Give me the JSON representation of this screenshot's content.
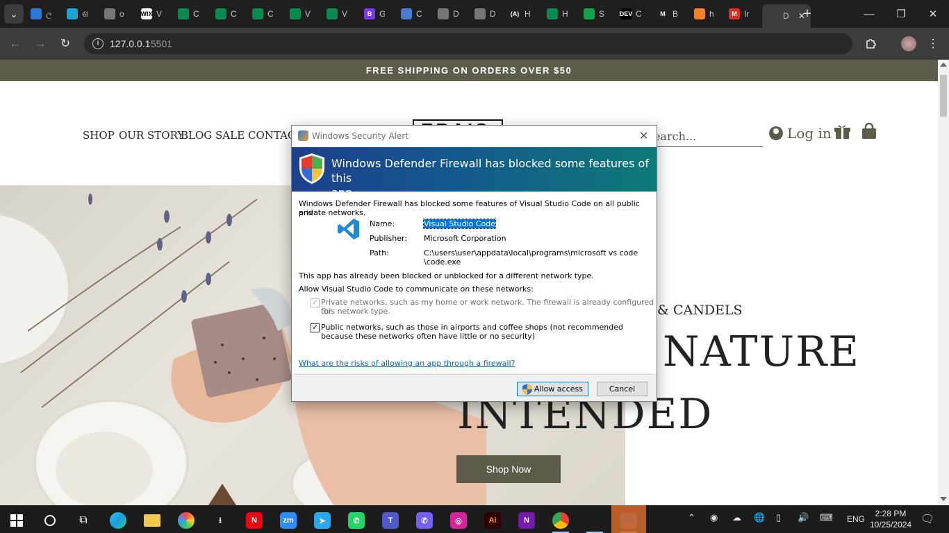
{
  "browser": {
    "tabs": [
      {
        "favicon": "person-icon",
        "color": "#2a7ad3",
        "title": "ල"
      },
      {
        "favicon": "play-icon",
        "color": "#1fa3d6",
        "title": "ଶ"
      },
      {
        "favicon": "globe-icon",
        "color": "#777777",
        "title": "o"
      },
      {
        "favicon": "wix-icon",
        "color": "#ffffff",
        "title": "V",
        "badge": "WIX"
      },
      {
        "favicon": "w-icon",
        "color": "#0b8a4f",
        "title": "C"
      },
      {
        "favicon": "w-icon",
        "color": "#0b8a4f",
        "title": "C"
      },
      {
        "favicon": "w-icon",
        "color": "#0b8a4f",
        "title": "C"
      },
      {
        "favicon": "w-icon",
        "color": "#0b8a4f",
        "title": "V"
      },
      {
        "favicon": "w-icon",
        "color": "#0b8a4f",
        "title": "V"
      },
      {
        "favicon": "b-icon",
        "color": "#7c3aed",
        "title": "G",
        "badge": "B"
      },
      {
        "favicon": "flag-icon",
        "color": "#4b7bd1",
        "title": "C"
      },
      {
        "favicon": "globe-icon",
        "color": "#777777",
        "title": "D"
      },
      {
        "favicon": "globe-icon",
        "color": "#777777",
        "title": "D"
      },
      {
        "favicon": "a-icon",
        "color": "#222222",
        "title": "H",
        "badge": "(A)"
      },
      {
        "favicon": "w-icon",
        "color": "#0b8a4f",
        "title": "H"
      },
      {
        "favicon": "s-icon",
        "color": "#16a34a",
        "title": "S"
      },
      {
        "favicon": "dev-icon",
        "color": "#000000",
        "title": "C",
        "badge": "DEV"
      },
      {
        "favicon": "m-icon",
        "color": "#222222",
        "title": "B",
        "badge": "M"
      },
      {
        "favicon": "stack-icon",
        "color": "#f48024",
        "title": "h"
      },
      {
        "favicon": "gmail-icon",
        "color": "#d93025",
        "title": "Ir",
        "badge": "M"
      },
      {
        "favicon": "page-icon",
        "color": "#3c3c3c",
        "title": "D",
        "active": true
      }
    ],
    "url_host": "127.0.0.1",
    "url_port": ":5501",
    "new_tab_glyph": "+",
    "tabsearch_glyph": "⌄"
  },
  "site": {
    "promo": "FREE SHIPPING ON ORDERS OVER $50",
    "nav": [
      "SHOP",
      "OUR STORY",
      "BLOG",
      "SALE",
      "CONTACT"
    ],
    "logo_text": "ERAIS",
    "search_placeholder": "Search...",
    "login": "Log in",
    "hero_tagline": "& CANDELS",
    "hero_line1": "NATURE",
    "hero_line2": "INTENDED",
    "shop_now": "Shop Now"
  },
  "dialog": {
    "title": "Windows Security Alert",
    "heading_line1": "Windows Defender Firewall has blocked some features of this",
    "heading_line2": "app",
    "intro_line1": "Windows Defender Firewall has blocked some features of Visual Studio Code on all public and",
    "intro_line2": "private networks.",
    "name_label": "Name:",
    "name_value": "Visual Studio Code",
    "publisher_label": "Publisher:",
    "publisher_value": "Microsoft Corporation",
    "path_label": "Path:",
    "path_value_line1": "C:\\users\\user\\appdata\\local\\programs\\microsoft vs code",
    "path_value_line2": "\\code.exe",
    "already_blocked": "This app has already been blocked or unblocked for a different network type.",
    "allow_label": "Allow Visual Studio Code to communicate on these networks:",
    "private_line1": "Private networks, such as my home or work network. The firewall is already configured for",
    "private_line2": "this network type.",
    "public_line1": "Public networks, such as those in airports and coffee shops (not recommended",
    "public_line2": "because these networks often have little or no security)",
    "risk_link": "What are the risks of allowing an app through a firewall?",
    "allow_button": "Allow access",
    "cancel_button": "Cancel"
  },
  "taskbar": {
    "apps": [
      {
        "name": "edge-icon",
        "color": "#1b9de2",
        "label": ""
      },
      {
        "name": "folder-icon",
        "color": "#f2c94c",
        "label": ""
      },
      {
        "name": "paint-icon",
        "color": "#3a86ff",
        "label": ""
      },
      {
        "name": "download-icon",
        "color": "#1c1c1c",
        "label": "⭳"
      },
      {
        "name": "netflix-icon",
        "color": "#e50914",
        "label": "N"
      },
      {
        "name": "zoom-icon",
        "color": "#2d8cff",
        "label": "zm"
      },
      {
        "name": "telegram-icon",
        "color": "#29a9eb",
        "label": "➤"
      },
      {
        "name": "whatsapp-icon",
        "color": "#25d366",
        "label": "✆"
      },
      {
        "name": "teams-icon",
        "color": "#5059c9",
        "label": "T"
      },
      {
        "name": "viber-icon",
        "color": "#7360f2",
        "label": "✆"
      },
      {
        "name": "instagram-icon",
        "color": "#d6249f",
        "label": "◎"
      },
      {
        "name": "illustrator-icon",
        "color": "#330000",
        "label": "Ai"
      },
      {
        "name": "onenote-icon",
        "color": "#7719aa",
        "label": "N"
      },
      {
        "name": "chrome-icon",
        "color": "#1c1c1c",
        "label": ""
      },
      {
        "name": "vscode-icon",
        "color": "#1c1c1c",
        "label": ""
      },
      {
        "name": "winrar-icon",
        "color": "#8a5a44",
        "label": ""
      }
    ],
    "language": "ENG",
    "time": "2:28 PM",
    "date": "10/25/2024"
  }
}
